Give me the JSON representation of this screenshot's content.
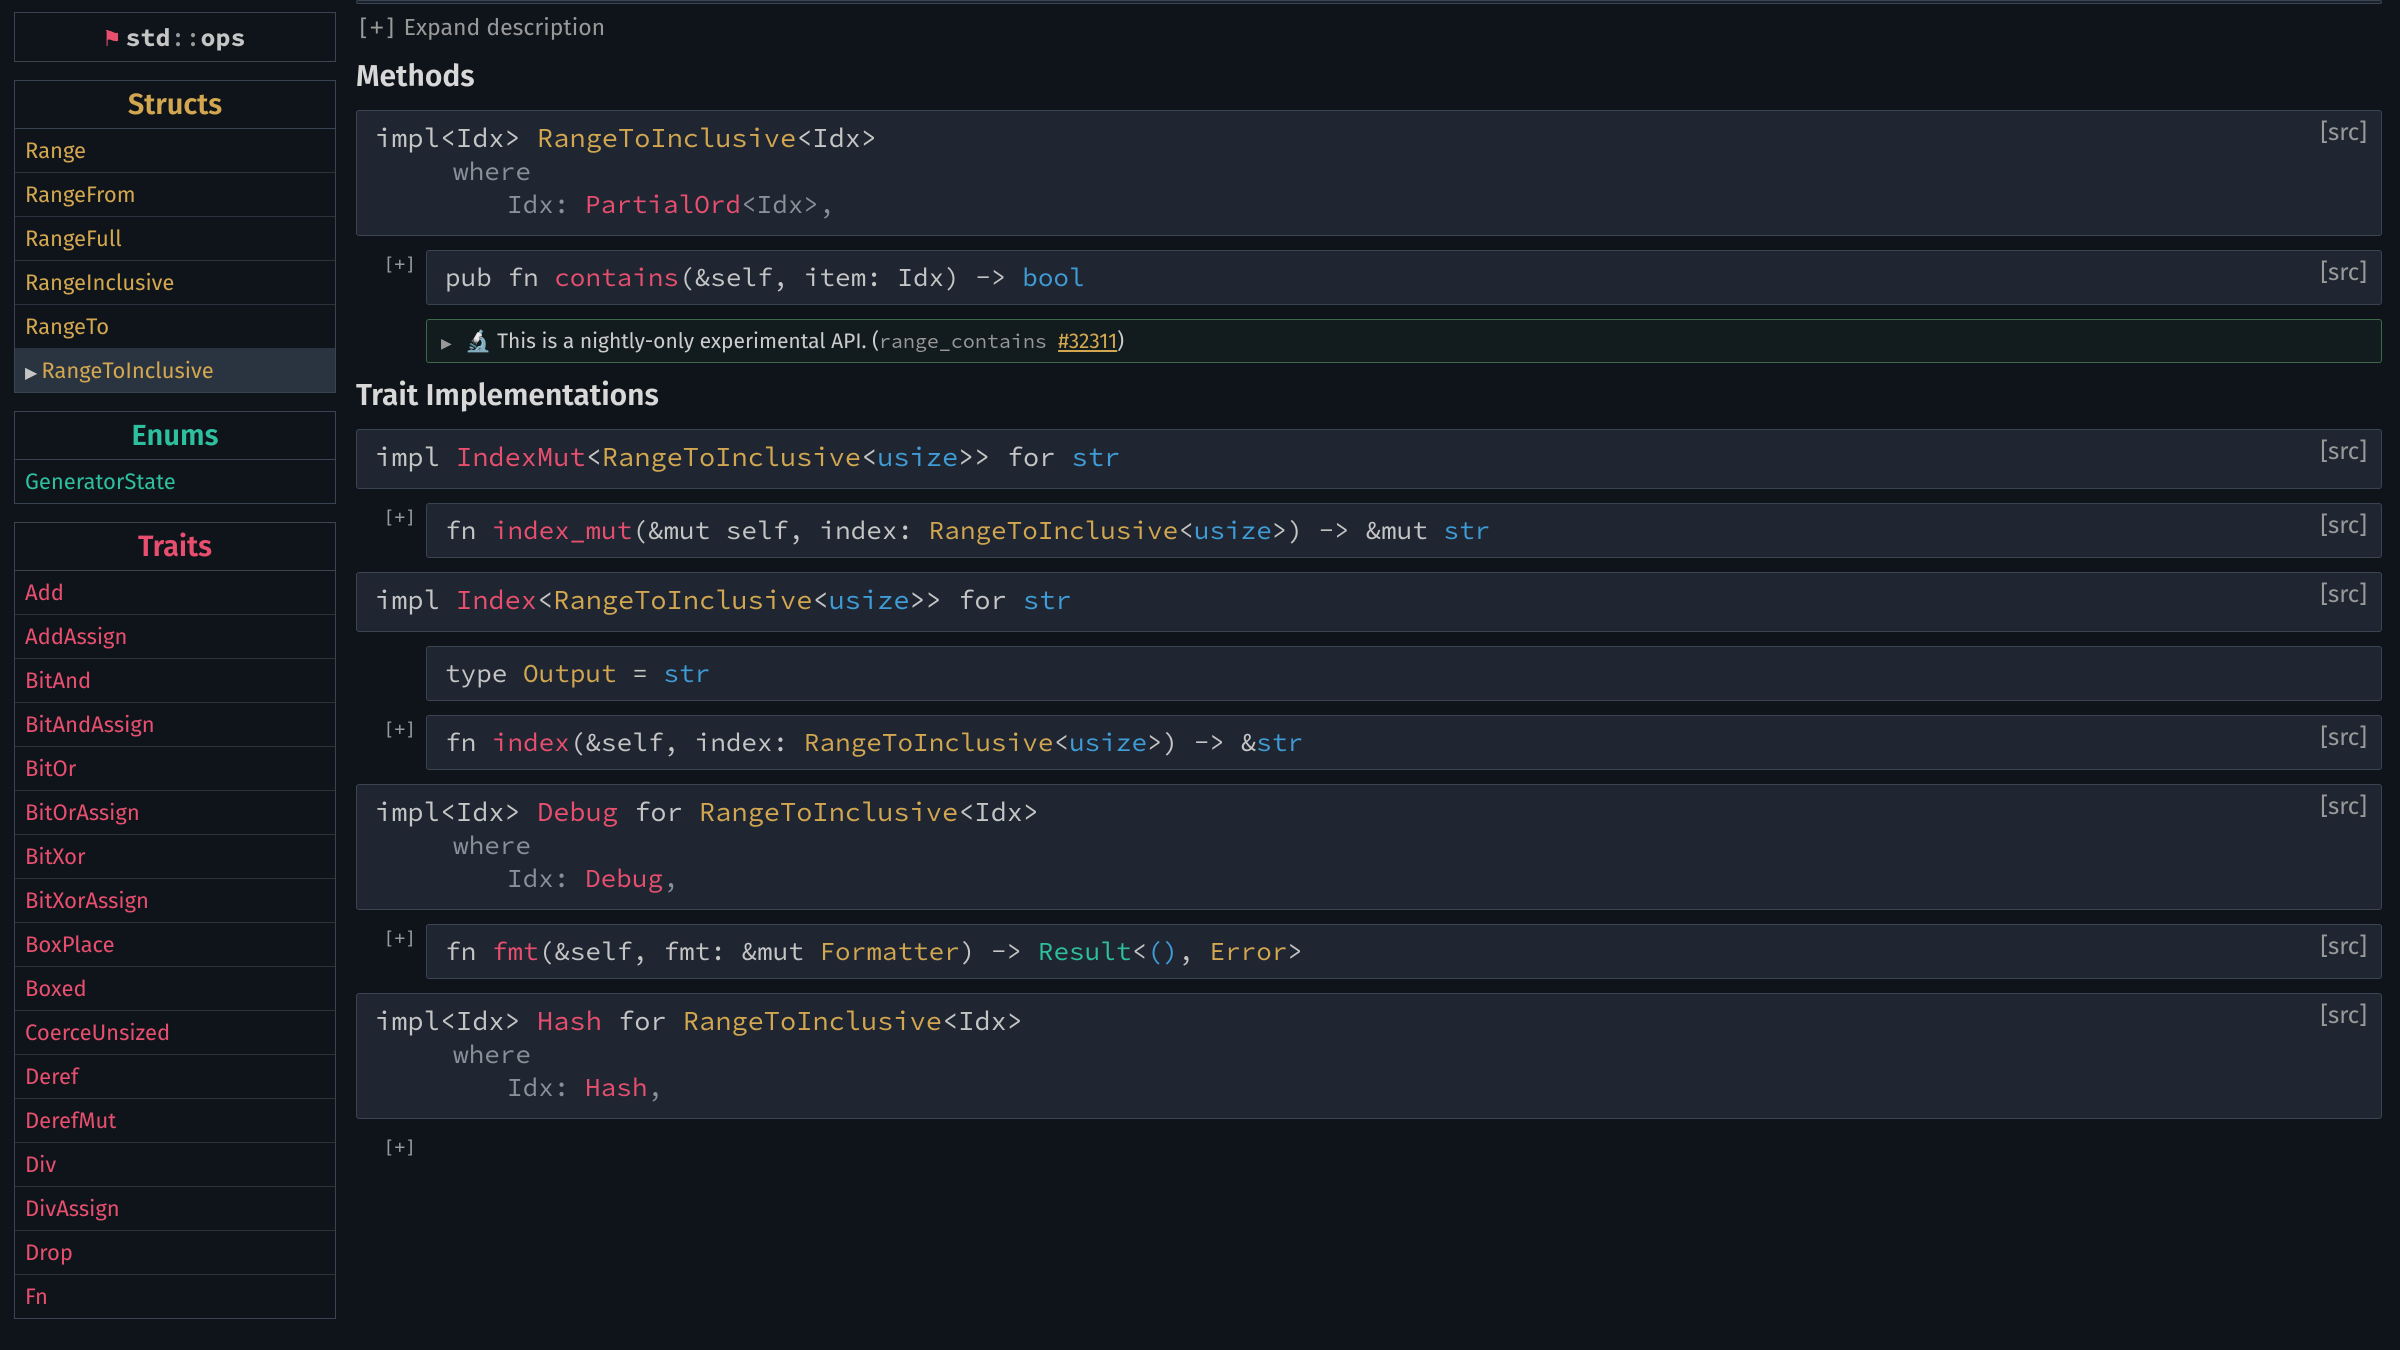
{
  "sidebar": {
    "crate": {
      "prefix": "std",
      "sep": "::",
      "mod": "ops"
    },
    "structs_header": "Structs",
    "structs": [
      "Range",
      "RangeFrom",
      "RangeFull",
      "RangeInclusive",
      "RangeTo",
      "RangeToInclusive"
    ],
    "structs_current": 5,
    "enums_header": "Enums",
    "enums": [
      "GeneratorState"
    ],
    "traits_header": "Traits",
    "traits": [
      "Add",
      "AddAssign",
      "BitAnd",
      "BitAndAssign",
      "BitOr",
      "BitOrAssign",
      "BitXor",
      "BitXorAssign",
      "BoxPlace",
      "Boxed",
      "CoerceUnsized",
      "Deref",
      "DerefMut",
      "Div",
      "DivAssign",
      "Drop",
      "Fn"
    ]
  },
  "main": {
    "expand": {
      "btn": "[+]",
      "label": "Expand description"
    },
    "methods_title": "Methods",
    "trait_impl_title": "Trait Implementations",
    "src": "[src]",
    "plus": "[+]",
    "impl1": {
      "t1": "impl<Idx> ",
      "struct": "RangeToInclusive",
      "t2": "<Idx>",
      "where": "where",
      "clause_pre": "Idx: ",
      "clause_trait": "PartialOrd",
      "clause_post": "<Idx>,",
      "method": {
        "pre": "pub fn ",
        "name": "contains",
        "post": "(&self, item: Idx) -> ",
        "ret": "bool"
      },
      "stab": {
        "text": "This is a nightly-only experimental API. (",
        "feat": "range_contains",
        "issue": "#32311",
        "close": ")"
      }
    },
    "impl2": {
      "t1": "impl ",
      "trait": "IndexMut",
      "t2": "<",
      "struct": "RangeToInclusive",
      "t3": "<",
      "prim": "usize",
      "t4": ">> for ",
      "for": "str",
      "method": {
        "pre": "fn ",
        "name": "index_mut",
        "post": "(&mut self, index: ",
        "arg_struct": "RangeToInclusive",
        "arg_b1": "<",
        "arg_prim": "usize",
        "arg_b2": ">) -> &mut ",
        "ret": "str"
      }
    },
    "impl3": {
      "t1": "impl ",
      "trait": "Index",
      "t2": "<",
      "struct": "RangeToInclusive",
      "t3": "<",
      "prim": "usize",
      "t4": ">> for ",
      "for": "str",
      "assoc": {
        "pre": "type ",
        "name": "Output",
        "eq": " = ",
        "val": "str"
      },
      "method": {
        "pre": "fn ",
        "name": "index",
        "post": "(&self, index: ",
        "arg_struct": "RangeToInclusive",
        "arg_b1": "<",
        "arg_prim": "usize",
        "arg_b2": ">) -> &",
        "ret": "str"
      }
    },
    "impl4": {
      "t1": "impl<Idx> ",
      "trait": "Debug",
      "t2": " for ",
      "struct": "RangeToInclusive",
      "t3": "<Idx>",
      "where": "where",
      "clause_pre": "Idx: ",
      "clause_trait": "Debug",
      "clause_post": ",",
      "method": {
        "pre": "fn ",
        "name": "fmt",
        "post": "(&self, fmt: &mut ",
        "fmtr": "Formatter",
        "post2": ") -> ",
        "res": "Result",
        "b1": "<",
        "unit": "()",
        "comma": ", ",
        "err": "Error",
        "b2": ">"
      }
    },
    "impl5": {
      "t1": "impl<Idx> ",
      "trait": "Hash",
      "t2": " for ",
      "struct": "RangeToInclusive",
      "t3": "<Idx>",
      "where": "where",
      "clause_pre": "Idx: ",
      "clause_trait": "Hash",
      "clause_post": ","
    }
  }
}
